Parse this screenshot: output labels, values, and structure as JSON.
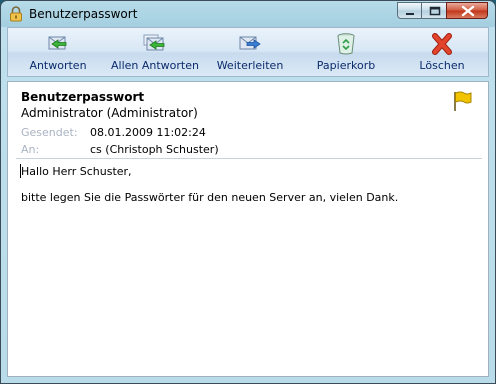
{
  "window": {
    "title": "Benutzerpasswort"
  },
  "toolbar": {
    "reply": "Antworten",
    "reply_all": "Allen Antworten",
    "forward": "Weiterleiten",
    "trash": "Papierkorb",
    "delete": "Löschen"
  },
  "message": {
    "subject": "Benutzerpasswort",
    "from": "Administrator (Administrator)",
    "sent_label": "Gesendet:",
    "sent_value": "08.01.2009 11:02:24",
    "to_label": "An:",
    "to_value": "cs (Christoph Schuster)",
    "greeting": "Hallo Herr Schuster,",
    "body": "bitte legen Sie die Passwörter für den neuen Server an, vielen Dank."
  },
  "colors": {
    "flag": "#f2c400",
    "delete_x": "#d9341f",
    "toolbar_label": "#0b2c6b"
  }
}
